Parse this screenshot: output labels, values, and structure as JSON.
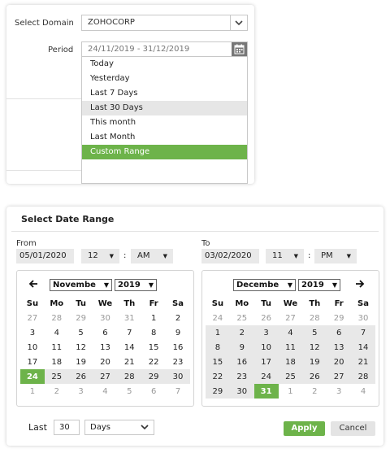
{
  "top": {
    "domain_label": "Select Domain",
    "domain_value": "ZOHOCORP",
    "period_label": "Period",
    "period_value": "24/11/2019 - 31/12/2019",
    "options": [
      {
        "label": "Today",
        "state": "normal"
      },
      {
        "label": "Yesterday",
        "state": "normal"
      },
      {
        "label": "Last 7 Days",
        "state": "normal"
      },
      {
        "label": "Last 30 Days",
        "state": "hover"
      },
      {
        "label": "This month",
        "state": "normal"
      },
      {
        "label": "Last Month",
        "state": "normal"
      },
      {
        "label": "Custom Range",
        "state": "selected"
      }
    ]
  },
  "range": {
    "title": "Select Date Range",
    "from": {
      "label": "From",
      "date": "05/01/2020",
      "hour": "12",
      "ampm": "AM"
    },
    "to": {
      "label": "To",
      "date": "03/02/2020",
      "hour": "11",
      "ampm": "PM"
    },
    "colon": ":",
    "weekdays": [
      "Su",
      "Mo",
      "Tu",
      "We",
      "Th",
      "Fr",
      "Sa"
    ],
    "left_cal": {
      "prev_arrow": "🡐",
      "month": "Novembe",
      "year": "2019",
      "weeks": [
        [
          {
            "d": "27",
            "m": "o"
          },
          {
            "d": "28",
            "m": "o"
          },
          {
            "d": "29",
            "m": "o"
          },
          {
            "d": "30",
            "m": "o"
          },
          {
            "d": "31",
            "m": "o"
          },
          {
            "d": "1",
            "m": "c"
          },
          {
            "d": "2",
            "m": "c"
          }
        ],
        [
          {
            "d": "3",
            "m": "c"
          },
          {
            "d": "4",
            "m": "c"
          },
          {
            "d": "5",
            "m": "c"
          },
          {
            "d": "6",
            "m": "c"
          },
          {
            "d": "7",
            "m": "c"
          },
          {
            "d": "8",
            "m": "c"
          },
          {
            "d": "9",
            "m": "c"
          }
        ],
        [
          {
            "d": "10",
            "m": "c"
          },
          {
            "d": "11",
            "m": "c"
          },
          {
            "d": "12",
            "m": "c"
          },
          {
            "d": "13",
            "m": "c"
          },
          {
            "d": "14",
            "m": "c"
          },
          {
            "d": "15",
            "m": "c"
          },
          {
            "d": "16",
            "m": "c"
          }
        ],
        [
          {
            "d": "17",
            "m": "c"
          },
          {
            "d": "18",
            "m": "c"
          },
          {
            "d": "19",
            "m": "c"
          },
          {
            "d": "20",
            "m": "c"
          },
          {
            "d": "21",
            "m": "c"
          },
          {
            "d": "22",
            "m": "c"
          },
          {
            "d": "23",
            "m": "c"
          }
        ],
        [
          {
            "d": "24",
            "m": "s"
          },
          {
            "d": "25",
            "m": "r"
          },
          {
            "d": "26",
            "m": "r"
          },
          {
            "d": "27",
            "m": "r"
          },
          {
            "d": "28",
            "m": "r"
          },
          {
            "d": "29",
            "m": "r"
          },
          {
            "d": "30",
            "m": "r"
          }
        ],
        [
          {
            "d": "1",
            "m": "o"
          },
          {
            "d": "2",
            "m": "o"
          },
          {
            "d": "3",
            "m": "o"
          },
          {
            "d": "4",
            "m": "o"
          },
          {
            "d": "5",
            "m": "o"
          },
          {
            "d": "6",
            "m": "o"
          },
          {
            "d": "7",
            "m": "o"
          }
        ]
      ]
    },
    "right_cal": {
      "next_arrow": "🡒",
      "month": "Decembe",
      "year": "2019",
      "weeks": [
        [
          {
            "d": "24",
            "m": "o"
          },
          {
            "d": "25",
            "m": "o"
          },
          {
            "d": "26",
            "m": "o"
          },
          {
            "d": "27",
            "m": "o"
          },
          {
            "d": "28",
            "m": "o"
          },
          {
            "d": "29",
            "m": "o"
          },
          {
            "d": "30",
            "m": "o"
          }
        ],
        [
          {
            "d": "1",
            "m": "r"
          },
          {
            "d": "2",
            "m": "r"
          },
          {
            "d": "3",
            "m": "r"
          },
          {
            "d": "4",
            "m": "r"
          },
          {
            "d": "5",
            "m": "r"
          },
          {
            "d": "6",
            "m": "r"
          },
          {
            "d": "7",
            "m": "r"
          }
        ],
        [
          {
            "d": "8",
            "m": "r"
          },
          {
            "d": "9",
            "m": "r"
          },
          {
            "d": "10",
            "m": "r"
          },
          {
            "d": "11",
            "m": "r"
          },
          {
            "d": "12",
            "m": "r"
          },
          {
            "d": "13",
            "m": "r"
          },
          {
            "d": "14",
            "m": "r"
          }
        ],
        [
          {
            "d": "15",
            "m": "r"
          },
          {
            "d": "16",
            "m": "r"
          },
          {
            "d": "17",
            "m": "r"
          },
          {
            "d": "18",
            "m": "r"
          },
          {
            "d": "19",
            "m": "r"
          },
          {
            "d": "20",
            "m": "r"
          },
          {
            "d": "21",
            "m": "r"
          }
        ],
        [
          {
            "d": "22",
            "m": "r"
          },
          {
            "d": "23",
            "m": "r"
          },
          {
            "d": "24",
            "m": "r"
          },
          {
            "d": "25",
            "m": "r"
          },
          {
            "d": "26",
            "m": "r"
          },
          {
            "d": "27",
            "m": "r"
          },
          {
            "d": "28",
            "m": "r"
          }
        ],
        [
          {
            "d": "29",
            "m": "r"
          },
          {
            "d": "30",
            "m": "r"
          },
          {
            "d": "31",
            "m": "s"
          },
          {
            "d": "1",
            "m": "o"
          },
          {
            "d": "2",
            "m": "o"
          },
          {
            "d": "3",
            "m": "o"
          },
          {
            "d": "4",
            "m": "o"
          }
        ]
      ]
    },
    "last_label": "Last",
    "last_value": "30",
    "last_unit": "Days",
    "apply_label": "Apply",
    "cancel_label": "Cancel"
  },
  "colors": {
    "accent": "#6db34a",
    "range_bg": "#e8e8e8",
    "hover_bg": "#e6e6e6"
  }
}
